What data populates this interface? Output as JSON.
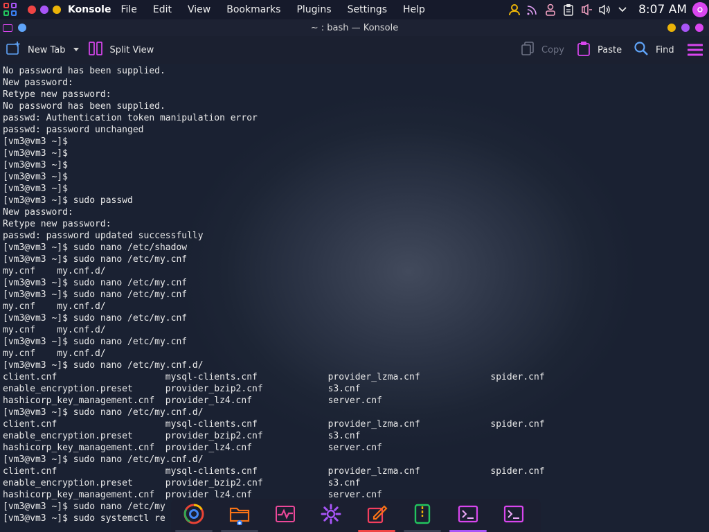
{
  "panel": {
    "app_name": "Konsole",
    "menu": [
      "File",
      "Edit",
      "View",
      "Bookmarks",
      "Plugins",
      "Settings",
      "Help"
    ],
    "tray_icons": [
      "user-icon",
      "rss-icon",
      "person-icon",
      "clipboard-icon",
      "mic-muted-icon",
      "volume-icon",
      "chevron-down-icon"
    ],
    "clock": "8:07 AM",
    "accent_colors": {
      "red": "#ef4444",
      "purple": "#a855f7",
      "yellow": "#eab308",
      "magenta": "#d946ef"
    }
  },
  "window": {
    "title": "~ : bash — Konsole"
  },
  "toolbar": {
    "new_tab_label": "New Tab",
    "split_view_label": "Split View",
    "copy_label": "Copy",
    "paste_label": "Paste",
    "find_label": "Find"
  },
  "terminal": {
    "lines": [
      "No password has been supplied.",
      "New password:",
      "Retype new password:",
      "No password has been supplied.",
      "passwd: Authentication token manipulation error",
      "passwd: password unchanged",
      "[vm3@vm3 ~]$",
      "[vm3@vm3 ~]$",
      "[vm3@vm3 ~]$",
      "[vm3@vm3 ~]$",
      "[vm3@vm3 ~]$",
      "[vm3@vm3 ~]$ sudo passwd",
      "New password:",
      "Retype new password:",
      "passwd: password updated successfully",
      "[vm3@vm3 ~]$ sudo nano /etc/shadow",
      "[vm3@vm3 ~]$ sudo nano /etc/my.cnf",
      "my.cnf    my.cnf.d/",
      "[vm3@vm3 ~]$ sudo nano /etc/my.cnf",
      "[vm3@vm3 ~]$ sudo nano /etc/my.cnf",
      "my.cnf    my.cnf.d/",
      "[vm3@vm3 ~]$ sudo nano /etc/my.cnf",
      "my.cnf    my.cnf.d/",
      "[vm3@vm3 ~]$ sudo nano /etc/my.cnf",
      "my.cnf    my.cnf.d/",
      "[vm3@vm3 ~]$ sudo nano /etc/my.cnf.d/",
      "client.cnf                    mysql-clients.cnf             provider_lzma.cnf             spider.cnf",
      "enable_encryption.preset      provider_bzip2.cnf            s3.cnf",
      "hashicorp_key_management.cnf  provider_lz4.cnf              server.cnf",
      "[vm3@vm3 ~]$ sudo nano /etc/my.cnf.d/",
      "client.cnf                    mysql-clients.cnf             provider_lzma.cnf             spider.cnf",
      "enable_encryption.preset      provider_bzip2.cnf            s3.cnf",
      "hashicorp_key_management.cnf  provider_lz4.cnf              server.cnf",
      "[vm3@vm3 ~]$ sudo nano /etc/my.cnf.d/",
      "client.cnf                    mysql-clients.cnf             provider_lzma.cnf             spider.cnf",
      "enable_encryption.preset      provider_bzip2.cnf            s3.cnf",
      "hashicorp_key_management.cnf  provider_lz4.cnf              server.cnf",
      "[vm3@vm3 ~]$ sudo nano /etc/my",
      "[vm3@vm3 ~]$ sudo systemctl re"
    ]
  },
  "dock": {
    "items": [
      {
        "icon": "chrome-icon",
        "color": "#4285f4"
      },
      {
        "icon": "folder-icon",
        "color": "#f97316"
      },
      {
        "icon": "system-monitor-icon",
        "color": "#ec4899"
      },
      {
        "icon": "settings-gear-icon",
        "color": "#a855f7"
      },
      {
        "icon": "text-editor-icon",
        "color": "#f43f5e"
      },
      {
        "icon": "archive-icon",
        "color": "#22c55e"
      },
      {
        "icon": "terminal-icon",
        "color": "#d946ef"
      },
      {
        "icon": "terminal-icon",
        "color": "#d946ef"
      }
    ]
  }
}
